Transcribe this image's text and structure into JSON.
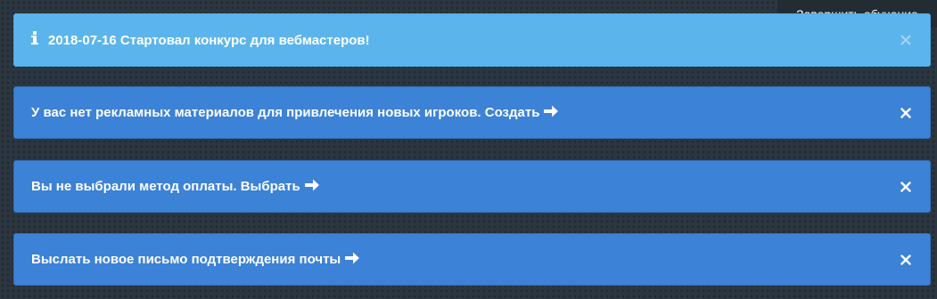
{
  "tooltip": {
    "finish_training": "Завершить обучение"
  },
  "alerts": [
    {
      "text": "2018-07-16 Стартовал конкурс для вебмастеров!",
      "icon": "info-icon",
      "color": "#5bb5ec"
    },
    {
      "text": "У вас нет рекламных материалов для привлечения новых игроков. Создать",
      "icon": "arrow-right-icon",
      "color": "#3c82d6"
    },
    {
      "text": "Вы не выбрали метод оплаты. Выбрать",
      "icon": "arrow-right-icon",
      "color": "#3c82d6"
    },
    {
      "text": "Выслать новое письмо подтверждения почты",
      "icon": "arrow-right-icon",
      "color": "#3c82d6"
    }
  ],
  "close_icon": "close-icon"
}
